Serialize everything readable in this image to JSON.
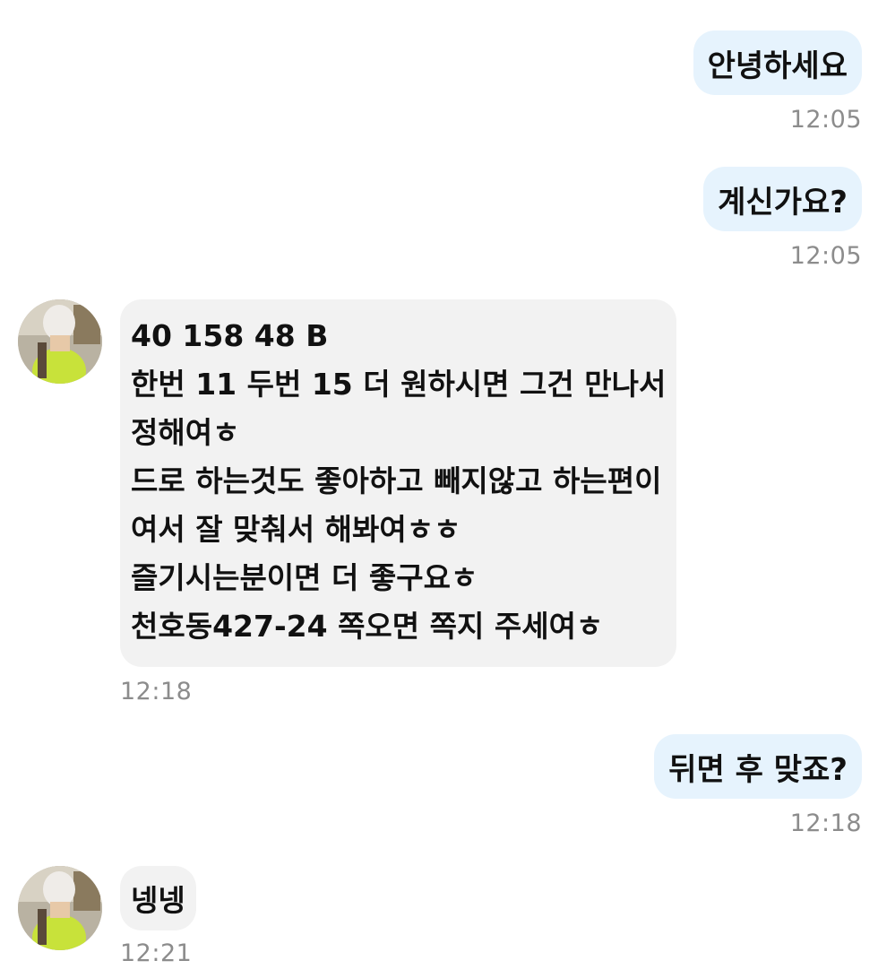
{
  "messages": [
    {
      "text": "안녕하세요",
      "time": "12:05"
    },
    {
      "text": "계신가요?",
      "time": "12:05"
    },
    {
      "lines": [
        "40 158 48 B",
        "한번 11 두번 15 더 원하시면 그건 만나서",
        "정해여ㅎ",
        "드로 하는것도 좋아하고 빼지않고 하는편이",
        "여서 잘 맞춰서 해봐여ㅎㅎ",
        "즐기시는분이면 더 좋구요ㅎ",
        "천호동427-24 쪽오면 쪽지 주세여ㅎ"
      ],
      "time": "12:18"
    },
    {
      "text": "뒤면 후 맞죠?",
      "time": "12:18"
    },
    {
      "text": "넹넹",
      "time": "12:21"
    }
  ]
}
